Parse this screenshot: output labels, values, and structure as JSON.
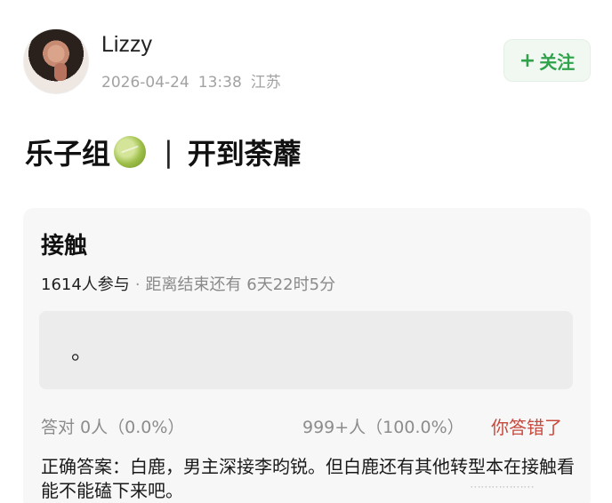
{
  "user": {
    "name": "Lizzy",
    "date": "2026-04-24",
    "time": "13:38",
    "location": "江苏"
  },
  "follow_button": {
    "plus": "+",
    "label": "关注"
  },
  "post": {
    "title_left": "乐子组",
    "title_sep": "|",
    "title_right": "开到荼蘼"
  },
  "poll": {
    "title": "接触",
    "participants": "1614人参与",
    "dot": "·",
    "deadline": "距离结束还有 6天22时5分",
    "option_text": "。",
    "result_left": "答对  0人（0.0%）",
    "result_right": "999+人（100.0%）",
    "wrong_label": "你答错了",
    "answer": "正确答案：白鹿，男主深接李昀锐。但白鹿还有其他转型本在接触看能不能磕下来吧。"
  },
  "watermark": "⋯⋯⋯⋯⋯⋯",
  "colors": {
    "accent_green": "#2fa24a",
    "wrong_red": "#c84a3e",
    "card_bg": "#f7f7f7"
  },
  "icons": [
    "avatar",
    "melon-icon"
  ]
}
